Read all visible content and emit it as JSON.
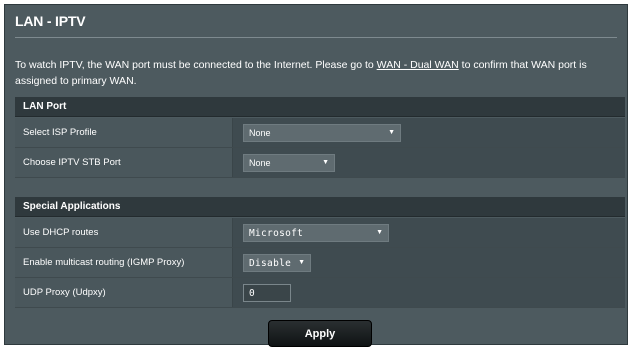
{
  "page": {
    "title": "LAN - IPTV",
    "description_pre": "To watch IPTV, the WAN port must be connected to the Internet. Please go to ",
    "description_link": "WAN - Dual WAN",
    "description_post": " to confirm that WAN port is assigned to primary WAN."
  },
  "lan_port": {
    "header": "LAN Port",
    "isp_profile": {
      "label": "Select ISP Profile",
      "value": "None"
    },
    "iptv_stb_port": {
      "label": "Choose IPTV STB Port",
      "value": "None"
    }
  },
  "special_apps": {
    "header": "Special Applications",
    "dhcp_routes": {
      "label": "Use DHCP routes",
      "value": "Microsoft"
    },
    "multicast": {
      "label": "Enable multicast routing (IGMP Proxy)",
      "value": "Disable"
    },
    "udp_proxy": {
      "label": "UDP Proxy (Udpxy)",
      "value": "0"
    }
  },
  "actions": {
    "apply_label": "Apply"
  },
  "icons": {
    "dropdown": "chevron-down-icon"
  },
  "colors": {
    "panel_bg": "#4d5a5f",
    "header_bg": "#2f393d",
    "button_bg": "#0f1314"
  }
}
